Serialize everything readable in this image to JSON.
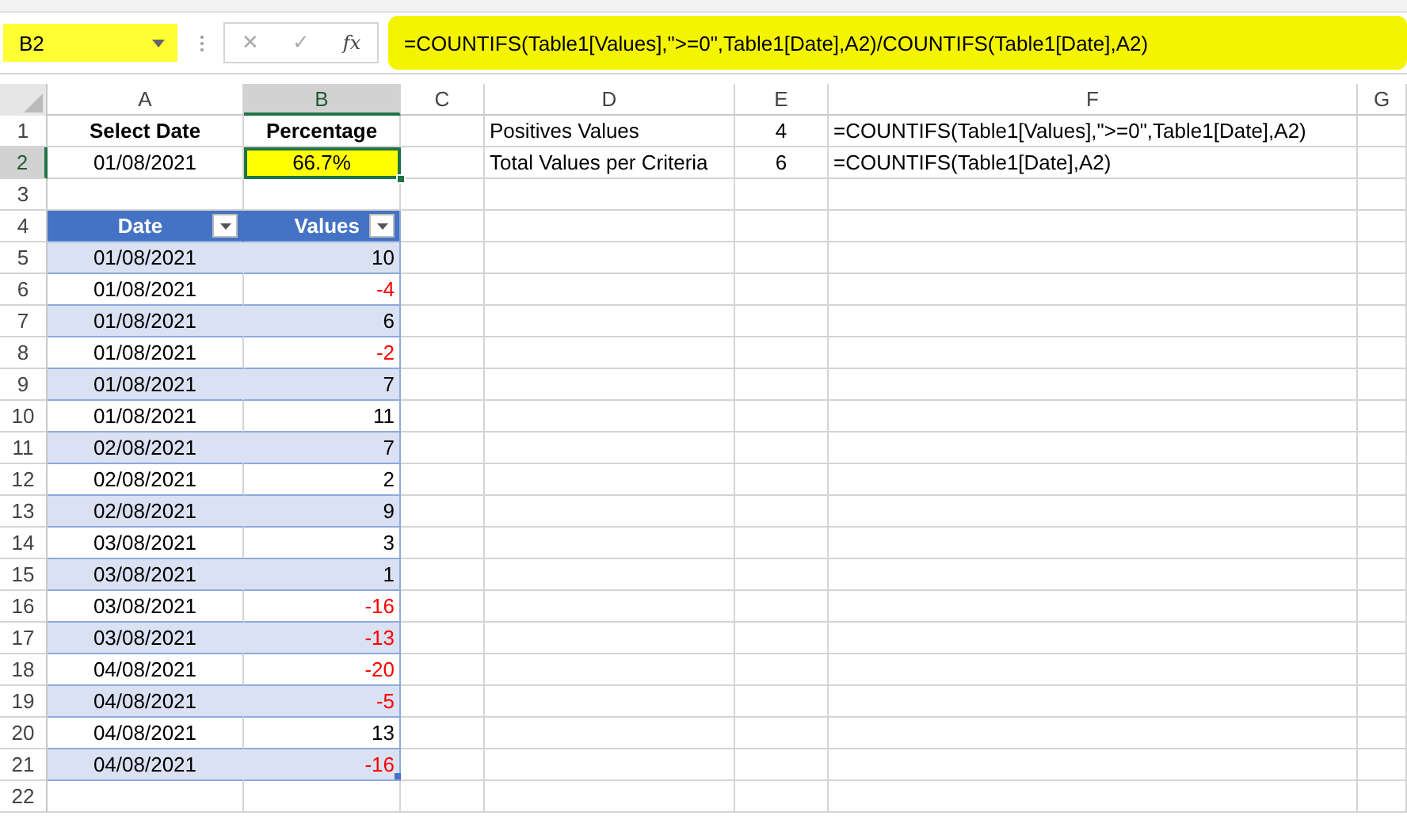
{
  "name_box": {
    "value": "B2"
  },
  "formula_bar": {
    "cancel": "✕",
    "enter": "✓",
    "function": "fx",
    "formula": "=COUNTIFS(Table1[Values],\">=0\",Table1[Date],A2)/COUNTIFS(Table1[Date],A2)"
  },
  "columns": [
    {
      "label": "A",
      "selected": false
    },
    {
      "label": "B",
      "selected": true
    },
    {
      "label": "C",
      "selected": false
    },
    {
      "label": "D",
      "selected": false
    },
    {
      "label": "E",
      "selected": false
    },
    {
      "label": "F",
      "selected": false
    },
    {
      "label": "G",
      "selected": false
    }
  ],
  "row_headers": [
    {
      "label": "1",
      "selected": false
    },
    {
      "label": "2",
      "selected": true
    },
    {
      "label": "3",
      "selected": false
    },
    {
      "label": "4",
      "selected": false
    },
    {
      "label": "5",
      "selected": false
    },
    {
      "label": "6",
      "selected": false
    },
    {
      "label": "7",
      "selected": false
    },
    {
      "label": "8",
      "selected": false
    },
    {
      "label": "9",
      "selected": false
    },
    {
      "label": "10",
      "selected": false
    },
    {
      "label": "11",
      "selected": false
    },
    {
      "label": "12",
      "selected": false
    },
    {
      "label": "13",
      "selected": false
    },
    {
      "label": "14",
      "selected": false
    },
    {
      "label": "15",
      "selected": false
    },
    {
      "label": "16",
      "selected": false
    },
    {
      "label": "17",
      "selected": false
    },
    {
      "label": "18",
      "selected": false
    },
    {
      "label": "19",
      "selected": false
    },
    {
      "label": "20",
      "selected": false
    },
    {
      "label": "21",
      "selected": false
    },
    {
      "label": "22",
      "selected": false
    }
  ],
  "summary": {
    "date_label": "Select Date",
    "percentage_label": "Percentage",
    "date": "01/08/2021",
    "percentage": "66.7%",
    "percentage_selected": true
  },
  "calculations": [
    {
      "label": "Positives Values",
      "count": "4",
      "formula": "=COUNTIFS(Table1[Values],\">=0\",Table1[Date],A2)"
    },
    {
      "label": "Total Values per Criteria",
      "count": "6",
      "formula": "=COUNTIFS(Table1[Date],A2)"
    }
  ],
  "table": {
    "columns": [
      "Date",
      "Values"
    ],
    "rows": [
      {
        "date": "01/08/2021",
        "value": "10",
        "negative": false
      },
      {
        "date": "01/08/2021",
        "value": "-4",
        "negative": true
      },
      {
        "date": "01/08/2021",
        "value": "6",
        "negative": false
      },
      {
        "date": "01/08/2021",
        "value": "-2",
        "negative": true
      },
      {
        "date": "01/08/2021",
        "value": "7",
        "negative": false
      },
      {
        "date": "01/08/2021",
        "value": "11",
        "negative": false
      },
      {
        "date": "02/08/2021",
        "value": "7",
        "negative": false
      },
      {
        "date": "02/08/2021",
        "value": "2",
        "negative": false
      },
      {
        "date": "02/08/2021",
        "value": "9",
        "negative": false
      },
      {
        "date": "03/08/2021",
        "value": "3",
        "negative": false
      },
      {
        "date": "03/08/2021",
        "value": "1",
        "negative": false
      },
      {
        "date": "03/08/2021",
        "value": "-16",
        "negative": true
      },
      {
        "date": "03/08/2021",
        "value": "-13",
        "negative": true
      },
      {
        "date": "04/08/2021",
        "value": "-20",
        "negative": true
      },
      {
        "date": "04/08/2021",
        "value": "-5",
        "negative": true
      },
      {
        "date": "04/08/2021",
        "value": "13",
        "negative": false
      },
      {
        "date": "04/08/2021",
        "value": "-16",
        "negative": true
      }
    ]
  }
}
